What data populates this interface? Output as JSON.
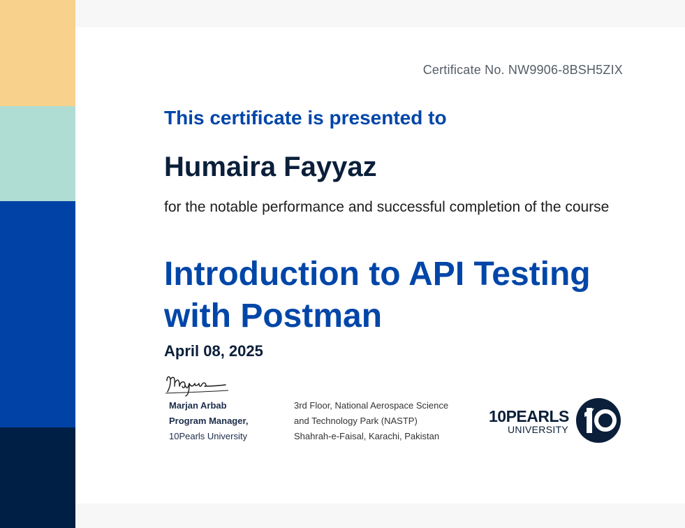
{
  "certificate": {
    "number_label": "Certificate No. NW9906-8BSH5ZIX",
    "presented_to_label": "This certificate is presented to",
    "recipient_name": "Humaira Fayyaz",
    "description": "for the notable performance and successful completion of the course",
    "course_title": "Introduction to API Testing with Postman",
    "date": "April 08, 2025"
  },
  "signer": {
    "name": "Marjan Arbab",
    "title": "Program Manager,",
    "organization": "10Pearls University"
  },
  "address": {
    "line1": "3rd Floor, National Aerospace Science",
    "line2": "and Technology Park (NASTP)",
    "line3": "Shahrah-e-Faisal, Karachi, Pakistan"
  },
  "logo": {
    "top_text": "10PEARLS",
    "bottom_text": "UNIVERSITY"
  },
  "colors": {
    "accent_blue": "#0046a8",
    "navy": "#0b1f3a",
    "stripe_yellow": "#f8d18c",
    "stripe_teal": "#b0ddd3",
    "stripe_blue": "#0042a6",
    "stripe_navy": "#001f44"
  }
}
